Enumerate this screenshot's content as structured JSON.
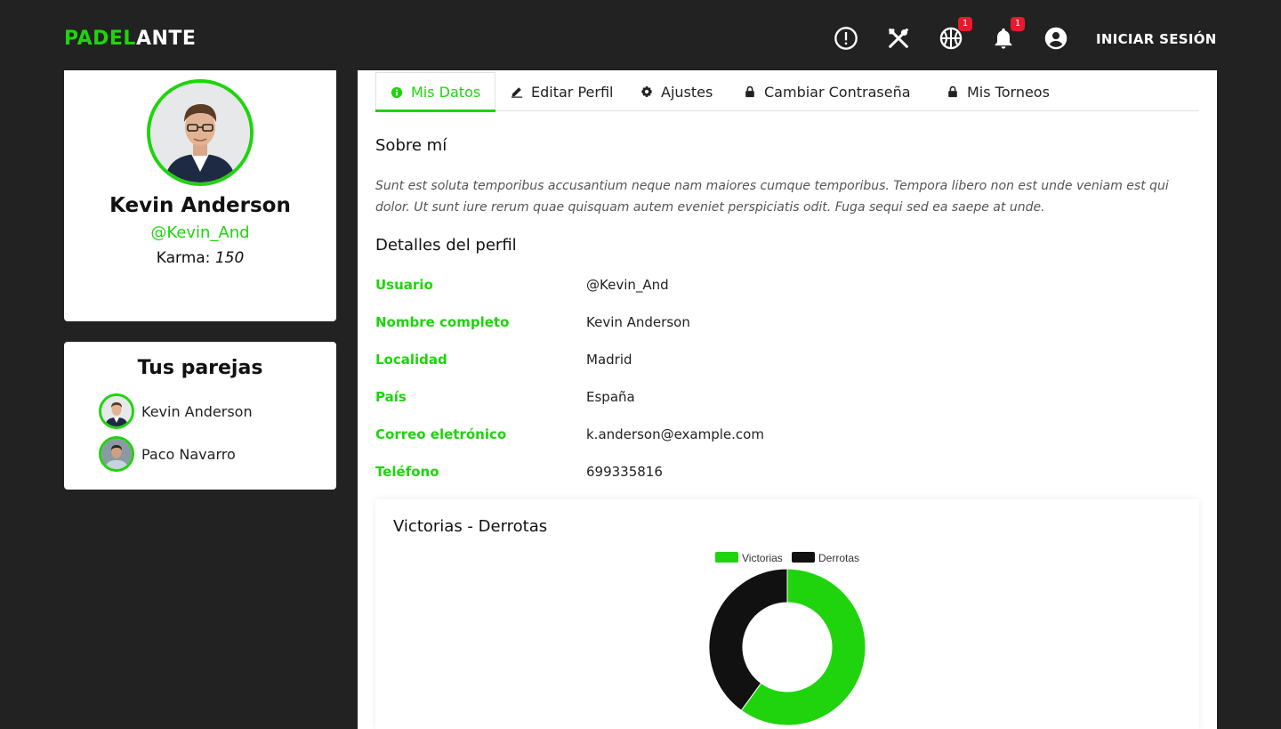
{
  "header": {
    "logo_part1": "PADEL",
    "logo_part2": "ANTE",
    "icons": [
      "alert-circle-icon",
      "tools-icon",
      "basketball-icon",
      "bell-icon",
      "account-circle-icon"
    ],
    "sport_badge": "1",
    "notification_badge": "1",
    "login_label": "INICIAR SESIÓN"
  },
  "profile": {
    "name": "Kevin Anderson",
    "username": "@Kevin_And",
    "karma_label": "Karma:",
    "karma_value": "150"
  },
  "partners": {
    "title": "Tus parejas",
    "items": [
      {
        "name": "Kevin Anderson"
      },
      {
        "name": "Paco Navarro"
      }
    ]
  },
  "tabs": [
    {
      "label": "Mis Datos",
      "icon": "info-icon",
      "active": true
    },
    {
      "label": "Editar Perfil",
      "icon": "pencil-icon",
      "active": false
    },
    {
      "label": "Ajustes",
      "icon": "gear-icon",
      "active": false
    },
    {
      "label": "Cambiar Contraseña",
      "icon": "lock-icon",
      "active": false
    },
    {
      "label": "Mis Torneos",
      "icon": "lock-icon",
      "active": false
    }
  ],
  "about": {
    "title": "Sobre mí",
    "text": "Sunt est soluta temporibus accusantium neque nam maiores cumque temporibus. Tempora libero non est unde veniam est qui dolor. Ut sunt iure rerum quae quisquam autem eveniet perspiciatis odit. Fuga sequi sed ea saepe at unde."
  },
  "details": {
    "title": "Detalles del perfil",
    "rows": [
      {
        "label": "Usuario",
        "value": "@Kevin_And"
      },
      {
        "label": "Nombre completo",
        "value": "Kevin Anderson"
      },
      {
        "label": "Localidad",
        "value": "Madrid"
      },
      {
        "label": "País",
        "value": "España"
      },
      {
        "label": "Correo eletrónico",
        "value": "k.anderson@example.com"
      },
      {
        "label": "Teléfono",
        "value": "699335816"
      }
    ]
  },
  "colors": {
    "accent": "#1fd40d",
    "dark": "#222222",
    "loss": "#111111",
    "badge": "#e51b2d"
  },
  "chart_data": {
    "type": "pie",
    "title": "Victorias - Derrotas",
    "categories": [
      "Victorias",
      "Derrotas"
    ],
    "values": [
      60,
      40
    ],
    "colors": [
      "#1fd40d",
      "#111111"
    ],
    "donut": true,
    "legend_position": "top"
  }
}
